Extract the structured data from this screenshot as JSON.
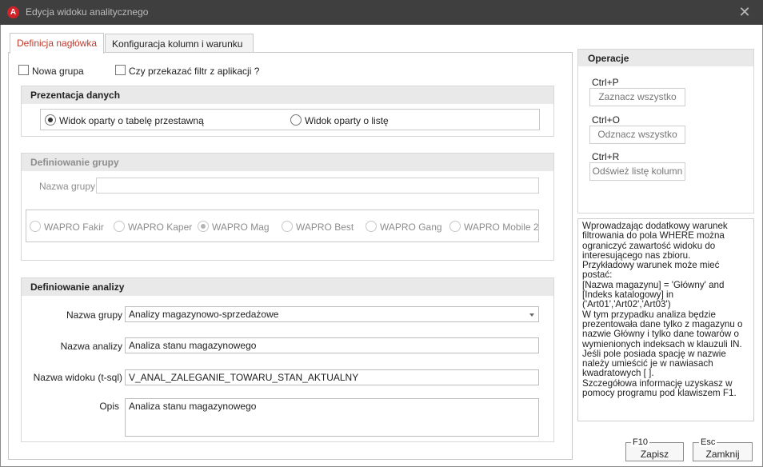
{
  "window": {
    "title": "Edycja widoku analitycznego",
    "app_icon_letter": "A"
  },
  "tabs": [
    {
      "label": "Definicja nagłówka",
      "active": true
    },
    {
      "label": "Konfiguracja kolumn  i warunku",
      "active": false
    }
  ],
  "checkboxes": {
    "nowa_grupa": "Nowa grupa",
    "przekazac_filtr": "Czy przekazać filtr z aplikacji ?"
  },
  "prezentacja": {
    "title": "Prezentacja danych",
    "options": [
      {
        "label": "Widok oparty o tabelę przestawną",
        "checked": true
      },
      {
        "label": "Widok oparty o listę",
        "checked": false
      }
    ]
  },
  "definiowanie_grupy": {
    "title": "Definiowanie grupy",
    "nazwa_grupy_label": "Nazwa grupy",
    "nazwa_grupy_value": "",
    "products": [
      {
        "label": "WAPRO Fakir",
        "checked": false
      },
      {
        "label": "WAPRO Kaper",
        "checked": false
      },
      {
        "label": "WAPRO Mag",
        "checked": true
      },
      {
        "label": "WAPRO Best",
        "checked": false
      },
      {
        "label": "WAPRO Gang",
        "checked": false
      },
      {
        "label": "WAPRO Mobile 2",
        "checked": false
      }
    ]
  },
  "definiowanie_analizy": {
    "title": "Definiowanie analizy",
    "nazwa_grupy_label": "Nazwa grupy",
    "nazwa_grupy_value": "Analizy magazynowo-sprzedażowe",
    "nazwa_analizy_label": "Nazwa analizy",
    "nazwa_analizy_value": "Analiza stanu magazynowego",
    "nazwa_widoku_label": "Nazwa widoku (t-sql)",
    "nazwa_widoku_value": "V_ANAL_ZALEGANIE_TOWARU_STAN_AKTUALNY",
    "opis_label": "Opis",
    "opis_value": "Analiza stanu magazynowego"
  },
  "operacje": {
    "title": "Operacje",
    "items": [
      {
        "shortcut": "Ctrl+P",
        "label": "Zaznacz wszystko"
      },
      {
        "shortcut": "Ctrl+O",
        "label": "Odznacz wszystko"
      },
      {
        "shortcut": "Ctrl+R",
        "label": "Odśwież listę kolumn"
      }
    ]
  },
  "info_text": "Wprowadzając dodatkowy warunek filtrowania do pola WHERE można ograniczyć zawartość widoku do interesującego nas zbioru.\nPrzykładowy warunek może mieć postać:\n[Nazwa magazynu] = 'Główny' and [Indeks katalogowy] in ('Art01','Art02','Art03')\nW tym przypadku analiza będzie prezentowała dane tylko z magazynu o nazwie Główny i tylko dane towarów o wymienionych indeksach w klauzuli IN.\nJeśli pole posiada spację w nazwie należy umieścić je w nawiasach kwadratowych [ ].\nSzczegółowa informację uzyskasz w pomocy programu pod klawiszem F1.",
  "buttons": {
    "save": {
      "key": "F10",
      "label": "Zapisz"
    },
    "close": {
      "key": "Esc",
      "label": "Zamknij"
    }
  },
  "colors": {
    "titlebar": "#3f3f3f",
    "active_tab_text": "#c0392b",
    "app_icon": "#d3232a",
    "group_header": "#e9e9e9"
  }
}
